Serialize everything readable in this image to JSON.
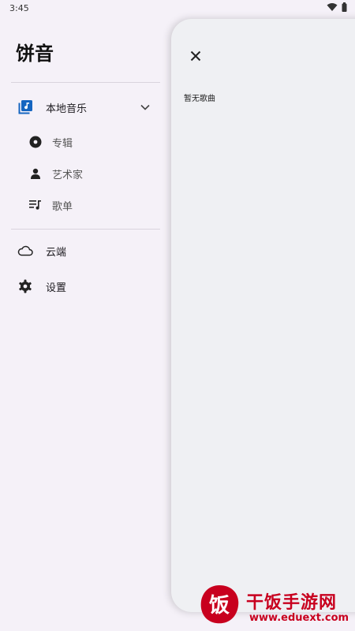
{
  "status": {
    "time": "3:45",
    "icons": [
      "wifi-icon",
      "battery-icon"
    ]
  },
  "drawer": {
    "title": "饼音",
    "local_music": {
      "label": "本地音乐",
      "icon": "library-music-icon",
      "expanded": true
    },
    "sub_items": [
      {
        "label": "专辑",
        "icon": "album-icon"
      },
      {
        "label": "艺术家",
        "icon": "person-icon"
      },
      {
        "label": "歌单",
        "icon": "playlist-icon"
      }
    ],
    "cloud": {
      "label": "云端",
      "icon": "cloud-icon"
    },
    "settings": {
      "label": "设置",
      "icon": "gear-icon"
    }
  },
  "panel": {
    "empty_text": "暂无歌曲",
    "close_icon": "close-icon"
  },
  "watermark": {
    "logo_text": "饭",
    "text": "干饭手游网",
    "url": "www.eduext.com"
  },
  "colors": {
    "accent": "#1565c0",
    "background": "#f5f1f8",
    "panel": "#eff0f3",
    "watermark": "#c8001e"
  }
}
